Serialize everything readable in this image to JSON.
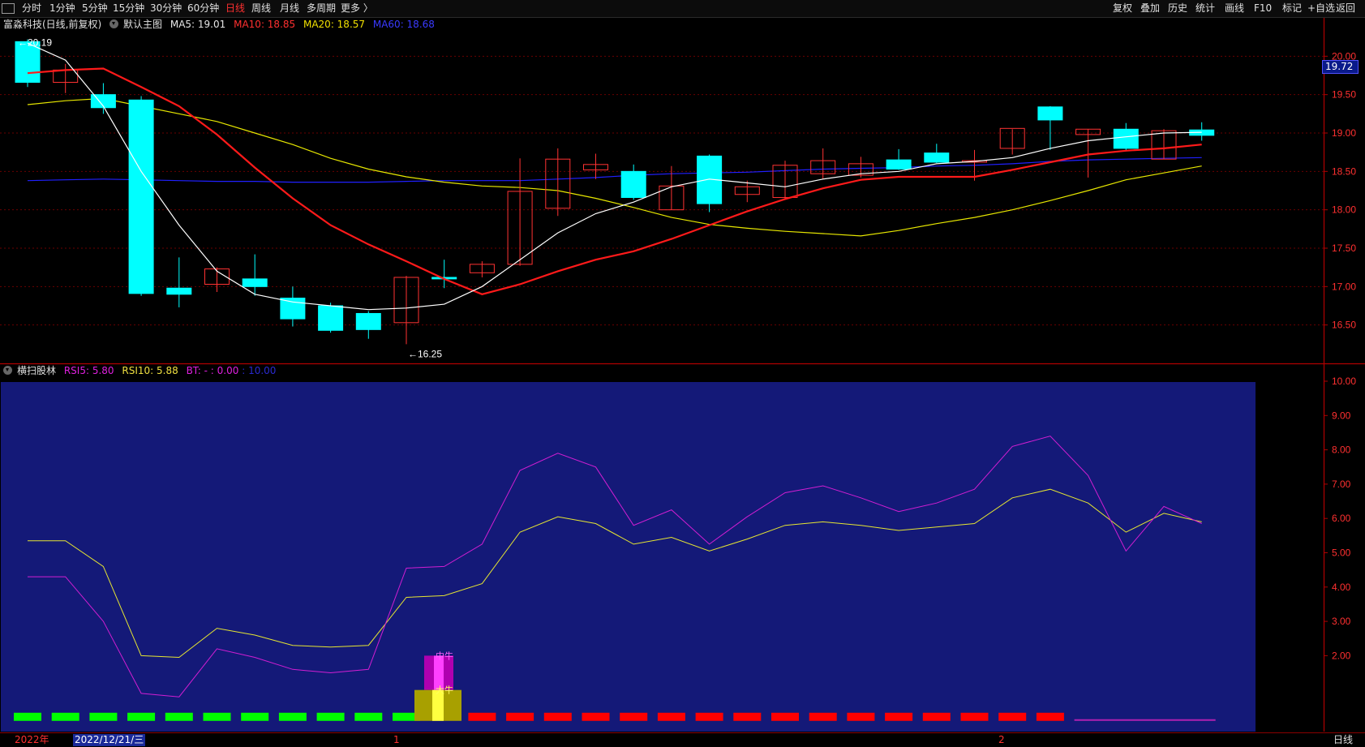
{
  "toolbar": {
    "left_items": [
      "分时",
      "1分钟",
      "5分钟",
      "15分钟",
      "30分钟",
      "60分钟",
      "日线",
      "周线",
      "月线",
      "多周期",
      "更多 〉"
    ],
    "active": "日线",
    "right_items": [
      "复权",
      "叠加",
      "历史",
      "统计",
      "画线",
      "F10",
      "+自选",
      "返回"
    ],
    "right_marker": "标记"
  },
  "main_legend": {
    "stock": "富淼科技(日线,前复权)",
    "template": "默认主图",
    "ma5": "MA5: 19.01",
    "ma10": "MA10: 18.85",
    "ma20": "MA20: 18.57",
    "ma60": "MA60: 18.68"
  },
  "sub_legend": {
    "name": "横扫股林",
    "rsi5": "RSI5: 5.80",
    "rsi10": "RSI10: 5.88",
    "bt": "BT: - : 0.00",
    "bt_extra": ": 10.00"
  },
  "annotations": {
    "high": "←20.19",
    "low": "←16.25",
    "mid_bull": "中牛",
    "big_bull": "大牛"
  },
  "current_price": "19.72",
  "bottom": {
    "year": "2022年",
    "cursor_date": "2022/12/21/三",
    "month1": "1",
    "month2": "2",
    "period": "日线"
  },
  "colors": {
    "up": "#ff3232",
    "down": "#00ffff",
    "ma5": "#ffffff",
    "ma10": "#ff1a1a",
    "ma20": "#e6e600",
    "ma60": "#2020ff",
    "rsi5": "#d21ed2",
    "rsi10": "#e6e632",
    "sub_bg": "#141978"
  },
  "chart_data": {
    "type": "candlestick",
    "main_axis": {
      "ticks": [
        "20.00",
        "19.50",
        "19.00",
        "18.50",
        "18.00",
        "17.50",
        "17.00",
        "16.50"
      ],
      "range": [
        16.0,
        20.5
      ]
    },
    "sub_axis": {
      "ticks": [
        "10.00",
        "9.00",
        "8.00",
        "7.00",
        "6.00",
        "5.00",
        "4.00",
        "3.00",
        "2.00"
      ],
      "range": [
        0,
        10
      ]
    },
    "candles": [
      {
        "o": 20.19,
        "h": 20.22,
        "l": 19.6,
        "c": 19.66
      },
      {
        "o": 19.66,
        "h": 19.9,
        "l": 19.52,
        "c": 19.82
      },
      {
        "o": 19.5,
        "h": 19.65,
        "l": 19.25,
        "c": 19.33
      },
      {
        "o": 19.43,
        "h": 19.48,
        "l": 16.88,
        "c": 16.91
      },
      {
        "o": 16.98,
        "h": 17.38,
        "l": 16.73,
        "c": 16.9
      },
      {
        "o": 17.03,
        "h": 17.25,
        "l": 16.93,
        "c": 17.23
      },
      {
        "o": 17.1,
        "h": 17.42,
        "l": 16.88,
        "c": 17.0
      },
      {
        "o": 16.85,
        "h": 17.0,
        "l": 16.48,
        "c": 16.58
      },
      {
        "o": 16.75,
        "h": 16.79,
        "l": 16.4,
        "c": 16.43
      },
      {
        "o": 16.65,
        "h": 16.68,
        "l": 16.32,
        "c": 16.44
      },
      {
        "o": 16.53,
        "h": 17.14,
        "l": 16.25,
        "c": 17.12
      },
      {
        "o": 17.12,
        "h": 17.35,
        "l": 16.98,
        "c": 17.1
      },
      {
        "o": 17.18,
        "h": 17.33,
        "l": 17.12,
        "c": 17.29
      },
      {
        "o": 17.29,
        "h": 18.67,
        "l": 17.27,
        "c": 18.24
      },
      {
        "o": 18.02,
        "h": 18.8,
        "l": 17.92,
        "c": 18.66
      },
      {
        "o": 18.52,
        "h": 18.73,
        "l": 18.4,
        "c": 18.59
      },
      {
        "o": 18.5,
        "h": 18.59,
        "l": 18.13,
        "c": 18.16
      },
      {
        "o": 18.0,
        "h": 18.57,
        "l": 18.0,
        "c": 18.31
      },
      {
        "o": 18.7,
        "h": 18.72,
        "l": 17.97,
        "c": 18.08
      },
      {
        "o": 18.2,
        "h": 18.38,
        "l": 18.1,
        "c": 18.3
      },
      {
        "o": 18.16,
        "h": 18.64,
        "l": 18.13,
        "c": 18.58
      },
      {
        "o": 18.47,
        "h": 18.8,
        "l": 18.4,
        "c": 18.64
      },
      {
        "o": 18.45,
        "h": 18.69,
        "l": 18.42,
        "c": 18.6
      },
      {
        "o": 18.65,
        "h": 18.79,
        "l": 18.52,
        "c": 18.53
      },
      {
        "o": 18.74,
        "h": 18.86,
        "l": 18.61,
        "c": 18.62
      },
      {
        "o": 18.62,
        "h": 18.78,
        "l": 18.38,
        "c": 18.64
      },
      {
        "o": 18.8,
        "h": 19.05,
        "l": 18.72,
        "c": 19.06
      },
      {
        "o": 19.34,
        "h": 19.35,
        "l": 18.78,
        "c": 19.17
      },
      {
        "o": 18.98,
        "h": 19.05,
        "l": 18.42,
        "c": 19.05
      },
      {
        "o": 19.05,
        "h": 19.13,
        "l": 18.77,
        "c": 18.8
      },
      {
        "o": 18.66,
        "h": 19.05,
        "l": 18.66,
        "c": 19.03
      },
      {
        "o": 19.04,
        "h": 19.14,
        "l": 18.9,
        "c": 18.97
      }
    ],
    "ma5": [
      20.17,
      19.95,
      19.35,
      18.5,
      17.8,
      17.2,
      16.9,
      16.8,
      16.75,
      16.7,
      16.72,
      16.77,
      17.0,
      17.35,
      17.7,
      17.95,
      18.1,
      18.3,
      18.4,
      18.35,
      18.3,
      18.4,
      18.47,
      18.5,
      18.6,
      18.63,
      18.68,
      18.8,
      18.9,
      18.95,
      19.0,
      19.01
    ],
    "ma10": [
      19.78,
      19.82,
      19.84,
      19.6,
      19.35,
      18.98,
      18.55,
      18.15,
      17.8,
      17.55,
      17.33,
      17.1,
      16.9,
      17.03,
      17.2,
      17.35,
      17.46,
      17.62,
      17.8,
      17.98,
      18.14,
      18.28,
      18.39,
      18.43,
      18.43,
      18.43,
      18.52,
      18.62,
      18.72,
      18.77,
      18.8,
      18.85
    ],
    "ma20": [
      19.37,
      19.42,
      19.45,
      19.35,
      19.25,
      19.15,
      19.0,
      18.85,
      18.67,
      18.53,
      18.43,
      18.36,
      18.31,
      18.29,
      18.25,
      18.15,
      18.03,
      17.9,
      17.81,
      17.76,
      17.72,
      17.69,
      17.66,
      17.73,
      17.82,
      17.9,
      18.0,
      18.12,
      18.25,
      18.39,
      18.48,
      18.57
    ],
    "ma60": [
      18.38,
      18.39,
      18.4,
      18.39,
      18.38,
      18.37,
      18.37,
      18.36,
      18.36,
      18.36,
      18.37,
      18.38,
      18.38,
      18.38,
      18.4,
      18.42,
      18.45,
      18.47,
      18.48,
      18.49,
      18.51,
      18.53,
      18.54,
      18.55,
      18.57,
      18.58,
      18.6,
      18.63,
      18.65,
      18.66,
      18.67,
      18.68
    ],
    "rsi5": [
      4.3,
      4.3,
      3.0,
      0.9,
      0.8,
      2.2,
      1.95,
      1.6,
      1.5,
      1.6,
      4.55,
      4.6,
      5.25,
      7.4,
      7.9,
      7.5,
      5.8,
      6.25,
      5.25,
      6.05,
      6.75,
      6.95,
      6.6,
      6.2,
      6.45,
      6.85,
      8.1,
      8.4,
      7.25,
      5.05,
      6.35,
      5.85
    ],
    "rsi10": [
      5.35,
      5.35,
      4.6,
      2.0,
      1.95,
      2.8,
      2.6,
      2.3,
      2.25,
      2.3,
      3.7,
      3.75,
      4.1,
      5.6,
      6.05,
      5.85,
      5.25,
      5.45,
      5.05,
      5.4,
      5.8,
      5.9,
      5.8,
      5.65,
      5.75,
      5.85,
      6.6,
      6.85,
      6.45,
      5.6,
      6.15,
      5.9
    ],
    "bt_colors": [
      "g",
      "g",
      "g",
      "g",
      "g",
      "g",
      "g",
      "g",
      "g",
      "g",
      "g",
      "y",
      "r",
      "r",
      "r",
      "r",
      "r",
      "r",
      "r",
      "r",
      "r",
      "r",
      "r",
      "r",
      "r",
      "r",
      "r",
      "r"
    ]
  }
}
